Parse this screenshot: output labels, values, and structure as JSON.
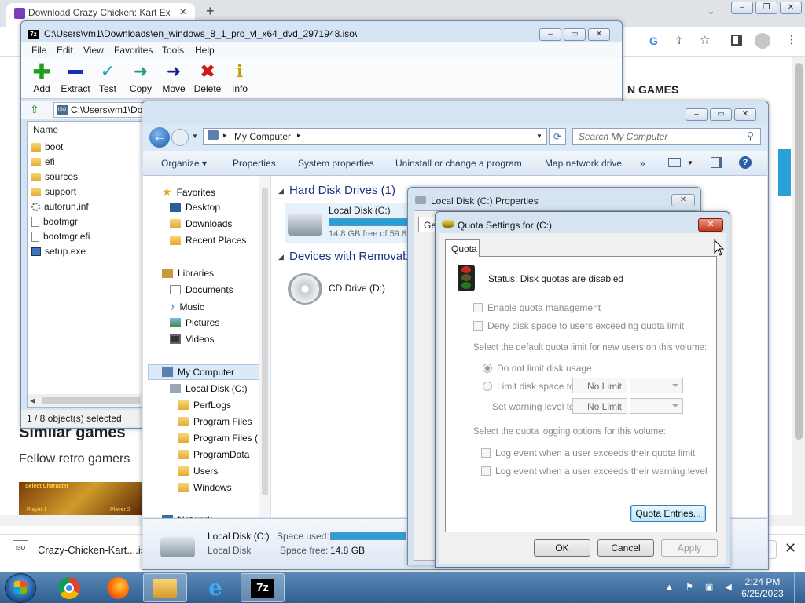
{
  "chrome": {
    "tab_title": "Download Crazy Chicken: Kart Ex",
    "tab_add": "+",
    "close_x": "✕",
    "page": {
      "heading": "N GAMES",
      "similar": "Similar games",
      "text": "Fellow retro gamers",
      "thumb_top": "Select Character",
      "thumb_p1": "Player 1",
      "thumb_p2": "Player 2"
    },
    "download": {
      "file": "Crazy-Chicken-Kart....is",
      "close": "✕"
    }
  },
  "sevenzip": {
    "title": "C:\\Users\\vm1\\Downloads\\en_windows_8_1_pro_vl_x64_dvd_2971948.iso\\",
    "menu": [
      "File",
      "Edit",
      "View",
      "Favorites",
      "Tools",
      "Help"
    ],
    "toolbar": [
      "Add",
      "Extract",
      "Test",
      "Copy",
      "Move",
      "Delete",
      "Info"
    ],
    "path": "C:\\Users\\vm1\\Do",
    "col_name": "Name",
    "files": [
      {
        "name": "boot",
        "type": "folder"
      },
      {
        "name": "efi",
        "type": "folder"
      },
      {
        "name": "sources",
        "type": "folder"
      },
      {
        "name": "support",
        "type": "folder"
      },
      {
        "name": "autorun.inf",
        "type": "config"
      },
      {
        "name": "bootmgr",
        "type": "file"
      },
      {
        "name": "bootmgr.efi",
        "type": "file"
      },
      {
        "name": "setup.exe",
        "type": "exe"
      }
    ],
    "status": "1 / 8 object(s) selected"
  },
  "explorer": {
    "address": "My Computer",
    "search_placeholder": "Search My Computer",
    "commands": [
      "Organize ▾",
      "Properties",
      "System properties",
      "Uninstall or change a program",
      "Map network drive",
      "»"
    ],
    "nav": {
      "favorites": "Favorites",
      "fav_items": [
        "Desktop",
        "Downloads",
        "Recent Places"
      ],
      "libraries": "Libraries",
      "lib_items": [
        "Documents",
        "Music",
        "Pictures",
        "Videos"
      ],
      "computer": "My Computer",
      "local_disk": "Local Disk (C:)",
      "disk_items": [
        "PerfLogs",
        "Program Files",
        "Program Files (",
        "ProgramData",
        "Users",
        "Windows"
      ],
      "network": "Network"
    },
    "groups": {
      "hdd": "Hard Disk Drives (1)",
      "removable": "Devices with Removab"
    },
    "drive_c": {
      "name": "Local Disk (C:)",
      "free": "14.8 GB free of 59.8"
    },
    "drive_d": {
      "name": "CD Drive (D:)"
    },
    "details": {
      "name": "Local Disk (C:)",
      "type": "Local Disk",
      "used_label": "Space used:",
      "free_label": "Space free:",
      "free_value": "14.8 GB"
    }
  },
  "properties": {
    "title": "Local Disk (C:) Properties",
    "tab": "Ge"
  },
  "quota": {
    "title": "Quota Settings for  (C:)",
    "tab": "Quota",
    "status": "Status:  Disk quotas are disabled",
    "enable": "Enable quota management",
    "deny": "Deny disk space to users exceeding quota limit",
    "default_label": "Select the default quota limit for new users on this volume:",
    "no_limit_radio": "Do not limit disk usage",
    "limit_radio": "Limit disk space to",
    "warning_label": "Set warning level to",
    "no_limit_value": "No Limit",
    "logging_label": "Select the quota logging options for this volume:",
    "log_quota": "Log event when a user exceeds their quota limit",
    "log_warning": "Log event when a user exceeds their warning level",
    "entries_button": "Quota Entries...",
    "ok": "OK",
    "cancel": "Cancel",
    "apply": "Apply"
  },
  "taskbar": {
    "time": "2:24 PM",
    "date": "6/25/2023",
    "apps": [
      "chrome",
      "firefox",
      "explorer",
      "ie",
      "7zip"
    ],
    "sevenzip_label": "7z"
  }
}
